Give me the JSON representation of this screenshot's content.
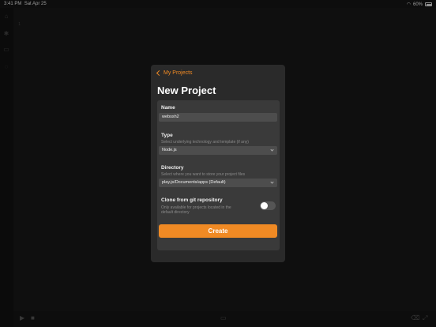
{
  "status_bar": {
    "time": "3:41 PM",
    "date": "Sat Apr 25",
    "battery": "60%"
  },
  "modal": {
    "back_label": "My Projects",
    "title": "New Project",
    "name": {
      "label": "Name",
      "value": "webssh2"
    },
    "type": {
      "label": "Type",
      "hint": "Select underlying technology and template (if any)",
      "value": "Node.js"
    },
    "directory": {
      "label": "Directory",
      "hint": "Select where you want to store your project files",
      "value": "play.js/Documents/apps (Default)"
    },
    "clone": {
      "label": "Clone from git repository",
      "hint_line1": "Only available for projects located in the",
      "hint_line2": "default directory",
      "enabled": false
    },
    "create_label": "Create"
  }
}
